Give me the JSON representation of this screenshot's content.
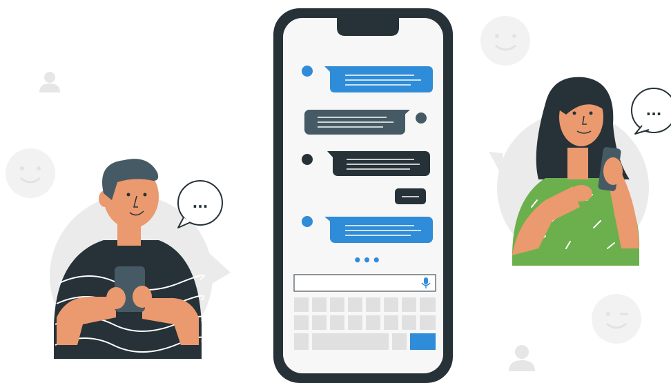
{
  "illustration": {
    "subject": "messaging",
    "colors": {
      "accent_blue": "#2F8CD8",
      "dark_slate": "#263238",
      "gray_bubble": "#455A64",
      "skin": "#EB996E",
      "hair_man": "#455A64",
      "hair_woman": "#263238",
      "woman_shirt": "#6BB04C",
      "background_circle": "#EBEBEB",
      "deco_gray": "#F0F0F0",
      "keyboard_key": "#E0E0E0",
      "screen": "#F7F7F7"
    },
    "icons": [
      "smiley-face-icon",
      "person-silhouette-icon",
      "speech-bubble-ellipsis-icon",
      "microphone-icon",
      "typing-indicator-icon"
    ]
  },
  "chat": {
    "messages": [
      {
        "sender": "left",
        "color": "blue"
      },
      {
        "sender": "right",
        "color": "gray"
      },
      {
        "sender": "left",
        "color": "dark"
      },
      {
        "sender": "right",
        "color": "dark",
        "short": true
      },
      {
        "sender": "left",
        "color": "blue"
      }
    ],
    "typing_indicator": "•••"
  },
  "speech_bubbles": {
    "man": "...",
    "woman": "..."
  },
  "keyboard": {
    "rows": 3,
    "send_key_color": "#2F8CD8"
  }
}
